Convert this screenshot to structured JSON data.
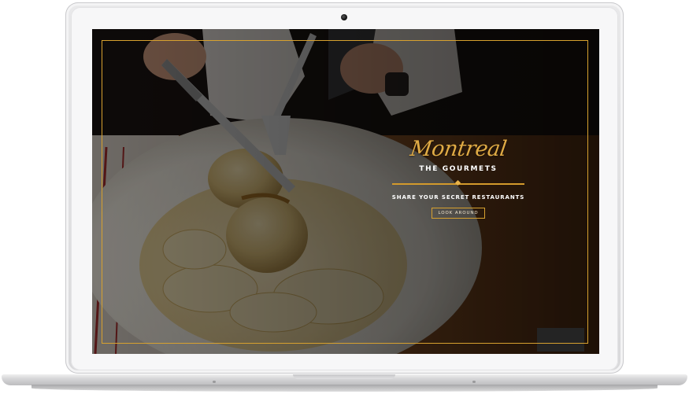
{
  "hero": {
    "script_title": "Montreal",
    "subtitle": "THE GOURMETS",
    "tagline": "SHARE YOUR SECRET RESTAURANTS",
    "cta_label": "LOOK AROUND"
  },
  "colors": {
    "accent": "#d7a12f",
    "script_gold": "#e0ab45",
    "overlay": "#1b120b"
  },
  "icons": {
    "divider": "diamond-ornament",
    "camera": "camera-dot"
  }
}
